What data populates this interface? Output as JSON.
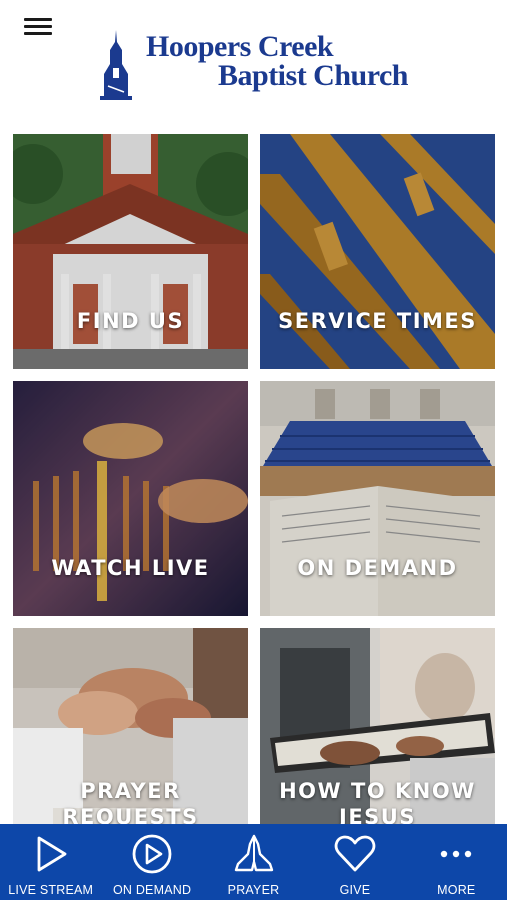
{
  "header": {
    "menu_icon": "hamburger-menu-icon",
    "logo_icon": "church-steeple-logo-icon",
    "logo_line1": "Hoopers Creek",
    "logo_line2": "Baptist Church",
    "brand_color": "#1b3a8f"
  },
  "tiles": [
    {
      "label": "FIND US"
    },
    {
      "label": "SERVICE TIMES"
    },
    {
      "label": "WATCH LIVE"
    },
    {
      "label": "ON DEMAND"
    },
    {
      "label_line1": "PRAYER",
      "label_line2": "REQUESTS"
    },
    {
      "label_line1": "HOW TO KNOW",
      "label_line2": "JESUS"
    }
  ],
  "tabbar": {
    "color": "#0d47a9",
    "items": [
      {
        "label": "LIVE STREAM",
        "icon": "play-triangle-icon"
      },
      {
        "label": "ON DEMAND",
        "icon": "play-circle-icon"
      },
      {
        "label": "PRAYER",
        "icon": "praying-hands-icon"
      },
      {
        "label": "GIVE",
        "icon": "heart-icon"
      },
      {
        "label": "MORE",
        "icon": "more-dots-icon"
      }
    ]
  }
}
